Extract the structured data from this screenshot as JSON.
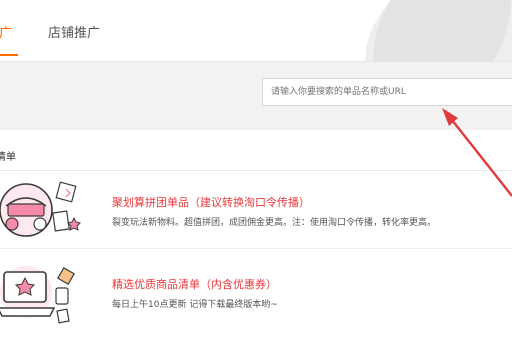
{
  "tabs": [
    {
      "label": "推广",
      "active": true
    },
    {
      "label": "店铺推广",
      "active": false
    }
  ],
  "search": {
    "placeholder": "请输入你要搜索的单品名称或URL"
  },
  "section": {
    "title": "清单"
  },
  "items": [
    {
      "title": "聚划算拼团单品（建议转换淘口令传播）",
      "desc": "裂变玩法新物料。超值拼团，成团佣金更高。注：使用淘口令传播，转化率更高。"
    },
    {
      "title": "精选优质商品清单（内含优惠券）",
      "desc": "每日上午10点更新 记得下载最终版本哟~"
    }
  ],
  "colors": {
    "accent": "#ff6a00",
    "title_red": "#e8393c",
    "arrow": "#e03a3a"
  }
}
